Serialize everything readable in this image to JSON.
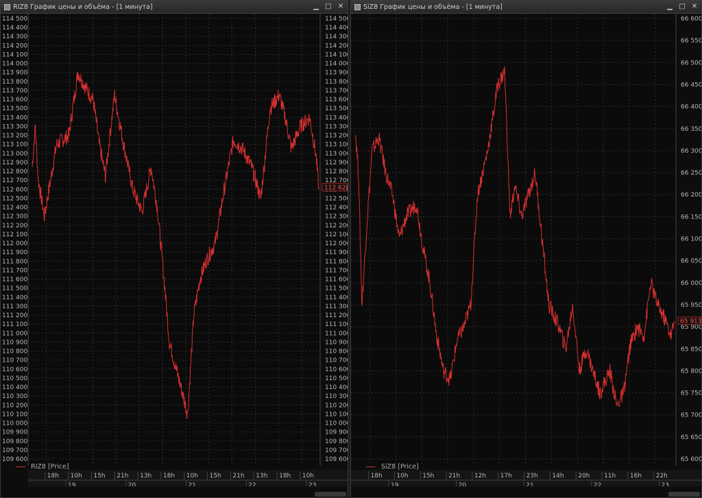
{
  "colors": {
    "price_line": "#d93030",
    "last_price_bg": "#a02020",
    "grid": "#2e2e2e",
    "axis_text": "#b8b8b8"
  },
  "windows": [
    {
      "title": "RIZ8 График цены и объёма - [1 минута]",
      "legend": "RIZ8 [Price]",
      "controls": [
        "minimize-icon",
        "maximize-icon",
        "close-icon"
      ],
      "last_price": "112 620",
      "x_top_labels": [
        "18h",
        "10h",
        "15h",
        "21h",
        "13h",
        "18h",
        "10h",
        "15h",
        "21h",
        "13h",
        "18h",
        "10h"
      ],
      "x_bottom_labels": [
        "19",
        "20",
        "21",
        "22",
        "23"
      ]
    },
    {
      "title": "SiZ8 График цены и объёма - [1 минута]",
      "legend": "SiZ8 [Price]",
      "controls": [
        "minimize-icon",
        "maximize-icon",
        "close-icon"
      ],
      "last_price": "65 913",
      "x_top_labels": [
        "18h",
        "10h",
        "15h",
        "21h",
        "12h",
        "17h",
        "23h",
        "14h",
        "20h",
        "11h",
        "16h",
        "22h"
      ],
      "x_bottom_labels": [
        "19",
        "20",
        "21",
        "22",
        "23"
      ]
    }
  ],
  "chart_data": [
    {
      "type": "line",
      "series": [
        {
          "name": "RIZ8 [Price]",
          "x": [
            0,
            5,
            10,
            20,
            40,
            60,
            75,
            90,
            100,
            110,
            120,
            135,
            150,
            165,
            180,
            195,
            205,
            215,
            225,
            240,
            255,
            265,
            275,
            285,
            300,
            315,
            330,
            345,
            360,
            375,
            390,
            405,
            415,
            425,
            440,
            455,
            465,
            470
          ],
          "y": [
            112850,
            113300,
            112700,
            112300,
            113100,
            113200,
            113900,
            113700,
            113600,
            113100,
            112750,
            113650,
            113100,
            112600,
            112350,
            112850,
            112400,
            111700,
            110900,
            110500,
            110100,
            111200,
            111600,
            111800,
            112000,
            112600,
            113150,
            113050,
            112850,
            112500,
            113500,
            113650,
            113400,
            113050,
            113300,
            113400,
            113000,
            112620
          ]
        }
      ],
      "ylim": [
        109600,
        114500
      ],
      "y_ticks": [
        "114 500",
        "114 400",
        "114 300",
        "114 200",
        "114 100",
        "114 000",
        "113 900",
        "113 800",
        "113 700",
        "113 600",
        "113 500",
        "113 400",
        "113 300",
        "113 200",
        "113 100",
        "113 000",
        "112 900",
        "112 800",
        "112 700",
        "112 600",
        "112 500",
        "112 400",
        "112 300",
        "112 200",
        "112 100",
        "112 000",
        "111 900",
        "111 800",
        "111 700",
        "111 600",
        "111 500",
        "111 400",
        "111 300",
        "111 200",
        "111 100",
        "111 000",
        "110 900",
        "110 800",
        "110 700",
        "110 600",
        "110 500",
        "110 400",
        "110 300",
        "110 200",
        "110 100",
        "110 000",
        "109 900",
        "109 800",
        "109 700",
        "109 600"
      ],
      "grid": true
    },
    {
      "type": "line",
      "series": [
        {
          "name": "SiZ8 [Price]",
          "x": [
            0,
            5,
            10,
            18,
            25,
            35,
            45,
            55,
            65,
            75,
            90,
            100,
            110,
            120,
            130,
            140,
            150,
            160,
            170,
            180,
            195,
            210,
            220,
            228,
            235,
            245,
            255,
            265,
            275,
            285,
            300,
            310,
            320,
            330,
            340,
            350,
            360,
            375,
            385,
            395,
            405,
            415,
            425,
            435,
            445,
            455,
            465,
            470
          ],
          "y": [
            66350,
            66250,
            65950,
            66150,
            66300,
            66330,
            66250,
            66200,
            66100,
            66150,
            66180,
            66080,
            66000,
            65880,
            65800,
            65780,
            65870,
            65900,
            65950,
            66200,
            66300,
            66450,
            66480,
            66150,
            66220,
            66150,
            66200,
            66250,
            66100,
            65950,
            65900,
            65850,
            65950,
            65800,
            65850,
            65800,
            65750,
            65800,
            65720,
            65750,
            65860,
            65900,
            65880,
            66000,
            65950,
            65920,
            65880,
            65913
          ]
        }
      ],
      "ylim": [
        65600,
        66600
      ],
      "y_ticks": [
        "66 600",
        "66 550",
        "66 500",
        "66 450",
        "66 400",
        "66 350",
        "66 300",
        "66 250",
        "66 200",
        "66 150",
        "66 100",
        "66 050",
        "66 000",
        "65 950",
        "65 900",
        "65 850",
        "65 800",
        "65 750",
        "65 700",
        "65 650",
        "65 600"
      ],
      "grid": true
    }
  ]
}
